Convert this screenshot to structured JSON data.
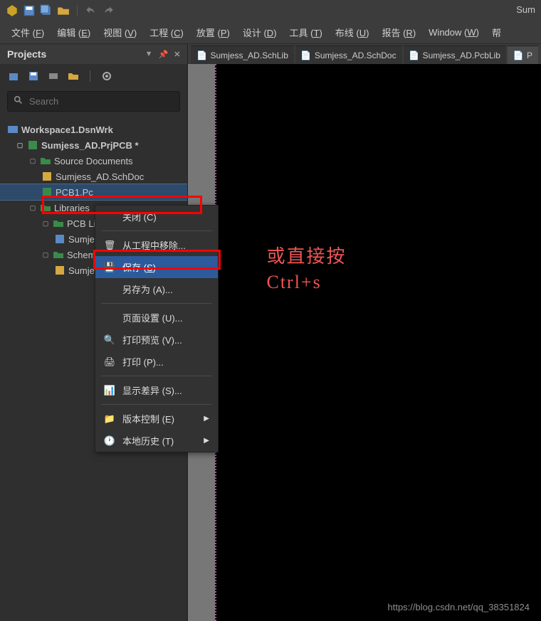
{
  "app": {
    "title": "Sum"
  },
  "menubar": [
    {
      "label": "文件 (F)",
      "u": "F"
    },
    {
      "label": "编辑 (E)",
      "u": "E"
    },
    {
      "label": "视图 (V)",
      "u": "V"
    },
    {
      "label": "工程 (C)",
      "u": "C"
    },
    {
      "label": "放置 (P)",
      "u": "P"
    },
    {
      "label": "设计 (D)",
      "u": "D"
    },
    {
      "label": "工具 (T)",
      "u": "T"
    },
    {
      "label": "布线 (U)",
      "u": "U"
    },
    {
      "label": "报告 (R)",
      "u": "R"
    },
    {
      "label": "Window (W)",
      "u": "W"
    },
    {
      "label": "帮",
      "u": ""
    }
  ],
  "projects": {
    "title": "Projects",
    "search_placeholder": "Search"
  },
  "tree": {
    "workspace": "Workspace1.DsnWrk",
    "project": "Sumjess_AD.PrjPCB *",
    "source_docs": "Source Documents",
    "schdoc": "Sumjess_AD.SchDoc",
    "pcb": "PCB1.Pc",
    "libraries": "Libraries",
    "pcb_lib_folder": "PCB Libr",
    "pcb_lib_item": "Sumje",
    "sch_lib_folder": "Schemat",
    "sch_lib_item": "Sumje"
  },
  "tabs": [
    {
      "label": "Sumjess_AD.SchLib"
    },
    {
      "label": "Sumjess_AD.SchDoc"
    },
    {
      "label": "Sumjess_AD.PcbLib"
    },
    {
      "label": "P"
    }
  ],
  "context_menu": {
    "close": "关闭 (C)",
    "remove": "从工程中移除...",
    "save": "保存 (S)",
    "save_as": "另存为 (A)...",
    "page_setup": "页面设置 (U)...",
    "print_preview": "打印预览 (V)...",
    "print": "打印 (P)...",
    "show_diff": "显示差异 (S)...",
    "version_control": "版本控制 (E)",
    "local_history": "本地历史 (T)"
  },
  "annotation": {
    "line1": "或直接按",
    "line2": "Ctrl+s"
  },
  "watermark": "https://blog.csdn.net/qq_38351824"
}
